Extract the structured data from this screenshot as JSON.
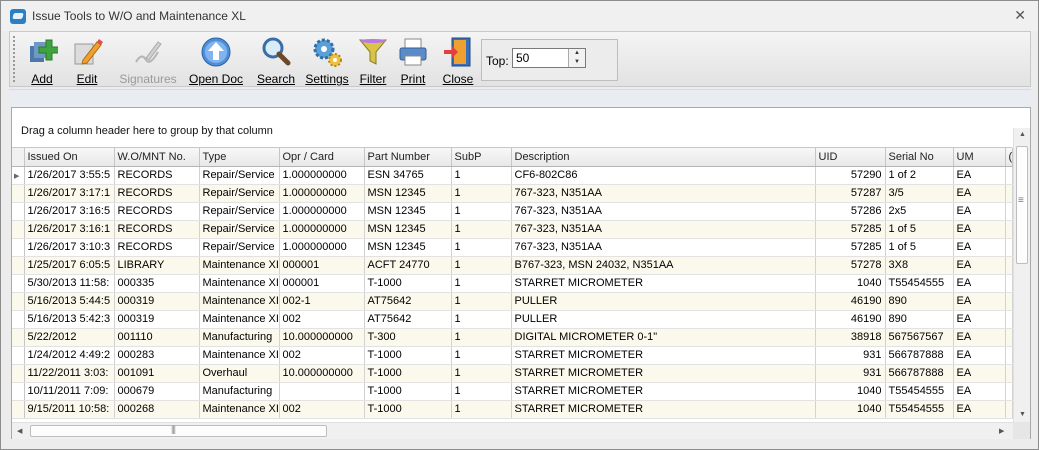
{
  "window": {
    "title": "Issue Tools to W/O and Maintenance XL",
    "close_glyph": "✕"
  },
  "toolbar": {
    "buttons": [
      {
        "label": "Add",
        "icon": "add-icon",
        "disabled": false
      },
      {
        "label": "Edit",
        "icon": "edit-pencil-icon",
        "disabled": false
      },
      {
        "label": "Signatures",
        "icon": "signatures-icon",
        "disabled": true
      },
      {
        "label": "Open Doc",
        "icon": "open-doc-arrow-icon",
        "disabled": false
      },
      {
        "label": "Search",
        "icon": "magnifier-icon",
        "disabled": false
      },
      {
        "label": "Settings",
        "icon": "gears-icon",
        "disabled": false
      },
      {
        "label": "Filter",
        "icon": "funnel-icon",
        "disabled": false
      },
      {
        "label": "Print",
        "icon": "printer-icon",
        "disabled": false
      },
      {
        "label": "Close",
        "icon": "exit-door-icon",
        "disabled": false
      }
    ],
    "top": {
      "label": "Top:",
      "value": "50"
    }
  },
  "grid": {
    "group_hint": "Drag a column header here to group by that column",
    "columns": [
      "Issued On",
      "W.O/MNT No.",
      "Type",
      "Opr / Card",
      "Part Number",
      "SubP",
      "Description",
      "UID",
      "Serial No",
      "UM",
      "("
    ],
    "rows": [
      [
        "1/26/2017 3:55:5",
        "RECORDS",
        "Repair/Service",
        "1.000000000",
        "ESN 34765",
        "1",
        "CF6-802C86",
        "57290",
        "1 of 2",
        "EA"
      ],
      [
        "1/26/2017 3:17:1",
        "RECORDS",
        "Repair/Service",
        "1.000000000",
        "MSN 12345",
        "1",
        "767-323, N351AA",
        "57287",
        "3/5",
        "EA"
      ],
      [
        "1/26/2017 3:16:5",
        "RECORDS",
        "Repair/Service",
        "1.000000000",
        "MSN 12345",
        "1",
        "767-323, N351AA",
        "57286",
        "2x5",
        "EA"
      ],
      [
        "1/26/2017 3:16:1",
        "RECORDS",
        "Repair/Service",
        "1.000000000",
        "MSN 12345",
        "1",
        "767-323, N351AA",
        "57285",
        "1 of 5",
        "EA"
      ],
      [
        "1/26/2017 3:10:3",
        "RECORDS",
        "Repair/Service",
        "1.000000000",
        "MSN 12345",
        "1",
        "767-323, N351AA",
        "57285",
        "1 of 5",
        "EA"
      ],
      [
        "1/25/2017 6:05:5",
        "LIBRARY",
        "Maintenance XI",
        "000001",
        "ACFT 24770",
        "1",
        "B767-323, MSN 24032, N351AA",
        "57278",
        "3X8",
        "EA"
      ],
      [
        "5/30/2013 11:58:",
        "000335",
        "Maintenance XI",
        "000001",
        "T-1000",
        "1",
        "STARRET MICROMETER",
        "1040",
        "T55454555",
        "EA"
      ],
      [
        "5/16/2013 5:44:5",
        "000319",
        "Maintenance XI",
        "002-1",
        "AT75642",
        "1",
        "PULLER",
        "46190",
        "890",
        "EA"
      ],
      [
        "5/16/2013 5:42:3",
        "000319",
        "Maintenance XI",
        "002",
        "AT75642",
        "1",
        "PULLER",
        "46190",
        "890",
        "EA"
      ],
      [
        "5/22/2012",
        "001110",
        "Manufacturing",
        "10.000000000",
        "T-300",
        "1",
        "DIGITAL MICROMETER 0-1\"",
        "38918",
        "567567567",
        "EA"
      ],
      [
        "1/24/2012 4:49:2",
        "000283",
        "Maintenance XI",
        "002",
        "T-1000",
        "1",
        "STARRET MICROMETER",
        "931",
        "566787888",
        "EA"
      ],
      [
        "11/22/2011 3:03:",
        "001091",
        "Overhaul",
        "10.000000000",
        "T-1000",
        "1",
        "STARRET MICROMETER",
        "931",
        "566787888",
        "EA"
      ],
      [
        "10/11/2011 7:09:",
        "000679",
        "Manufacturing",
        "",
        "T-1000",
        "1",
        "STARRET MICROMETER",
        "1040",
        "T55454555",
        "EA"
      ],
      [
        "9/15/2011 10:58:",
        "000268",
        "Maintenance XI",
        "002",
        "T-1000",
        "1",
        "STARRET MICROMETER",
        "1040",
        "T55454555",
        "EA"
      ]
    ]
  }
}
